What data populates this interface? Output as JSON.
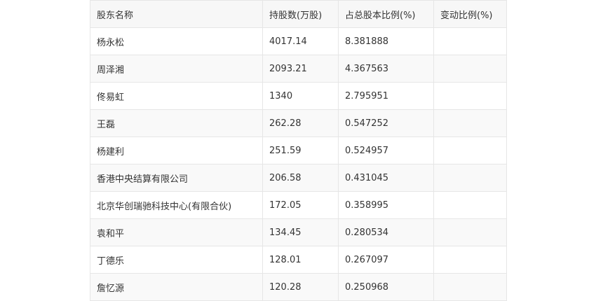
{
  "table": {
    "headers": [
      "股东名称",
      "持股数(万股)",
      "占总股本比例(%)",
      "变动比例(%)"
    ],
    "rows": [
      [
        "杨永松",
        "4017.14",
        "8.381888",
        ""
      ],
      [
        "周泽湘",
        "2093.21",
        "4.367563",
        ""
      ],
      [
        "佟易虹",
        "1340",
        "2.795951",
        ""
      ],
      [
        "王磊",
        "262.28",
        "0.547252",
        ""
      ],
      [
        "杨建利",
        "251.59",
        "0.524957",
        ""
      ],
      [
        "香港中央结算有限公司",
        "206.58",
        "0.431045",
        ""
      ],
      [
        "北京华创瑞驰科技中心(有限合伙)",
        "172.05",
        "0.358995",
        ""
      ],
      [
        "袁和平",
        "134.45",
        "0.280534",
        ""
      ],
      [
        "丁德乐",
        "128.01",
        "0.267097",
        ""
      ],
      [
        "詹忆源",
        "120.28",
        "0.250968",
        ""
      ]
    ]
  }
}
